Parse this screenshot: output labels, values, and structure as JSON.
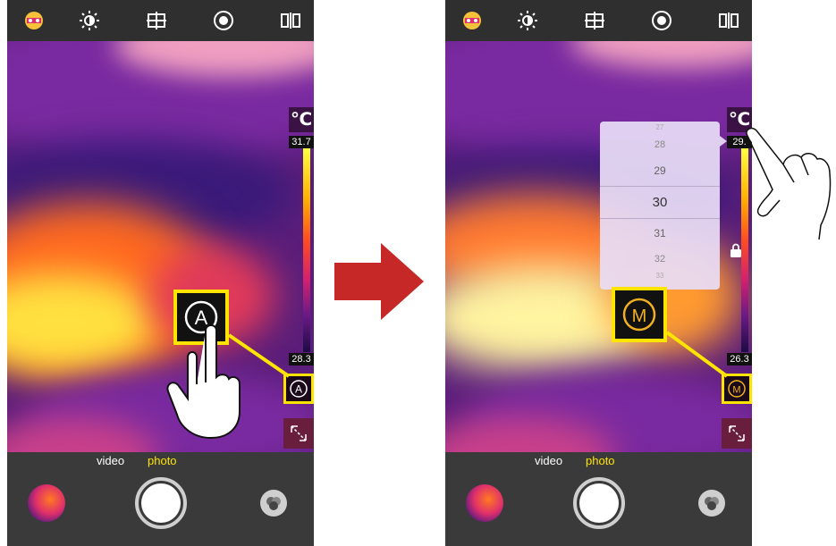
{
  "left_screen": {
    "scale": {
      "unit": "℃",
      "max": "31.7",
      "min": "28.3"
    },
    "mode_small_label": "A",
    "mode_big_label": "A"
  },
  "right_screen": {
    "scale": {
      "unit": "℃",
      "max": "29.",
      "min": "26.3"
    },
    "mode_small_label": "M",
    "mode_big_label": "M",
    "picker": {
      "values": [
        "27",
        "28",
        "29",
        "30",
        "31",
        "32",
        "33"
      ],
      "selected": "30"
    }
  },
  "bottom_bar": {
    "tabs": [
      {
        "label": "video"
      },
      {
        "label": "photo"
      }
    ],
    "active_tab": "photo"
  },
  "top_icons": [
    "palette-icon",
    "brightness-icon",
    "crosshair-icon",
    "lens-icon",
    "split-view-icon"
  ],
  "colors": {
    "accent": "#ffe400",
    "arrow": "#c62828",
    "panel_bg": "#3a3a3a"
  }
}
